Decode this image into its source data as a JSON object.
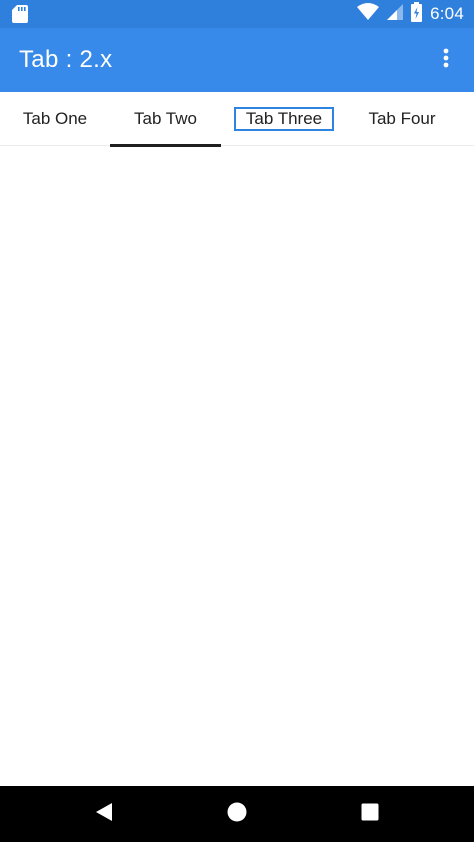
{
  "status_bar": {
    "time": "6:04",
    "icons": [
      "sd-card-icon",
      "wifi-icon",
      "cell-signal-icon",
      "battery-charging-icon"
    ]
  },
  "app_bar": {
    "title": "Tab : 2.x",
    "overflow_icon": "more-vert-icon"
  },
  "tabs": [
    {
      "label": "Tab One",
      "selected": false
    },
    {
      "label": "Tab Two",
      "selected": true
    },
    {
      "label": "Tab Three",
      "selected": false,
      "focused": true
    },
    {
      "label": "Tab Four",
      "selected": false
    }
  ],
  "nav_bar": {
    "buttons": [
      "back-icon",
      "home-icon",
      "recents-icon"
    ]
  },
  "colors": {
    "status_bar": "#2f7fdc",
    "app_bar": "#378ae9",
    "tab_indicator": "#1f1f1f",
    "focus_outline": "#2d83e0",
    "nav_bar": "#000000"
  }
}
